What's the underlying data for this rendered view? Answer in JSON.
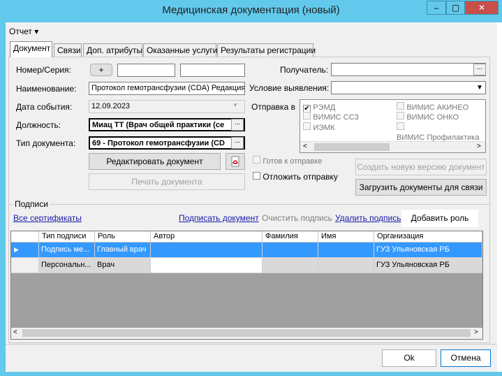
{
  "window": {
    "title": "Медицинская документация (новый)",
    "min": "–",
    "max": "▢",
    "close": "✕"
  },
  "menu": {
    "report": "Отчет ▾"
  },
  "tabs": [
    "Документ",
    "Связи",
    "Доп. атрибуты",
    "Оказанные услуги",
    "Результаты регистрации"
  ],
  "form": {
    "number_label": "Номер/Серия:",
    "plus": "+",
    "name_label": "Наименование:",
    "name_value": "Протокол гемотрансфузии (CDA) Редакция 5",
    "date_label": "Дата события:",
    "date_value": "12.09.2023",
    "position_label": "Должность:",
    "position_value": "Миац ТТ (Врач общей практики (се",
    "doctype_label": "Тип документа:",
    "doctype_value": "69 - Протокол гемотрансфузии (CD",
    "recipient_label": "Получатель:",
    "condition_label": "Условие выявления:",
    "send_label": "Отправка в",
    "edit_btn": "Редактировать документ",
    "print_btn": "Печать документа",
    "ready_label": "Готов к отправке",
    "delay_label": "Отложить отправку",
    "new_version_btn": "Создать новую версию документ",
    "upload_btn": "Загрузить документы для связи",
    "ellipsis": "..."
  },
  "send_targets": [
    {
      "label": "РЭМД",
      "checked": true
    },
    {
      "label": "ВИМИС ССЗ",
      "checked": false
    },
    {
      "label": "ИЭМК",
      "checked": false
    },
    {
      "label": "ВИМИС АКИНЕО",
      "checked": false
    },
    {
      "label": "ВИМИС ОНКО",
      "checked": false
    },
    {
      "label": "ВИМИС Профилактика",
      "checked": false
    }
  ],
  "signatures": {
    "title": "Подписи",
    "all_certs": "Все сертификаты",
    "sign": "Подписать документ",
    "clear": "Очистить подпись",
    "delete": "Удалить подпись",
    "add_role": "Добавить роль",
    "columns": [
      "Тип подписи",
      "Роль",
      "Автор",
      "Фамилия",
      "Имя",
      "Организация"
    ],
    "rows": [
      [
        "Подпись ме...",
        "Главный врач",
        "",
        "",
        "",
        "ГУЗ Ульяновская РБ"
      ],
      [
        "Персональн...",
        "Врач",
        "",
        "",
        "",
        "ГУЗ Ульяновская РБ"
      ]
    ]
  },
  "footer": {
    "ok": "Ok",
    "cancel": "Отмена"
  },
  "colors": {
    "titlebar": "#63c9ec",
    "selection": "#3399ff"
  }
}
